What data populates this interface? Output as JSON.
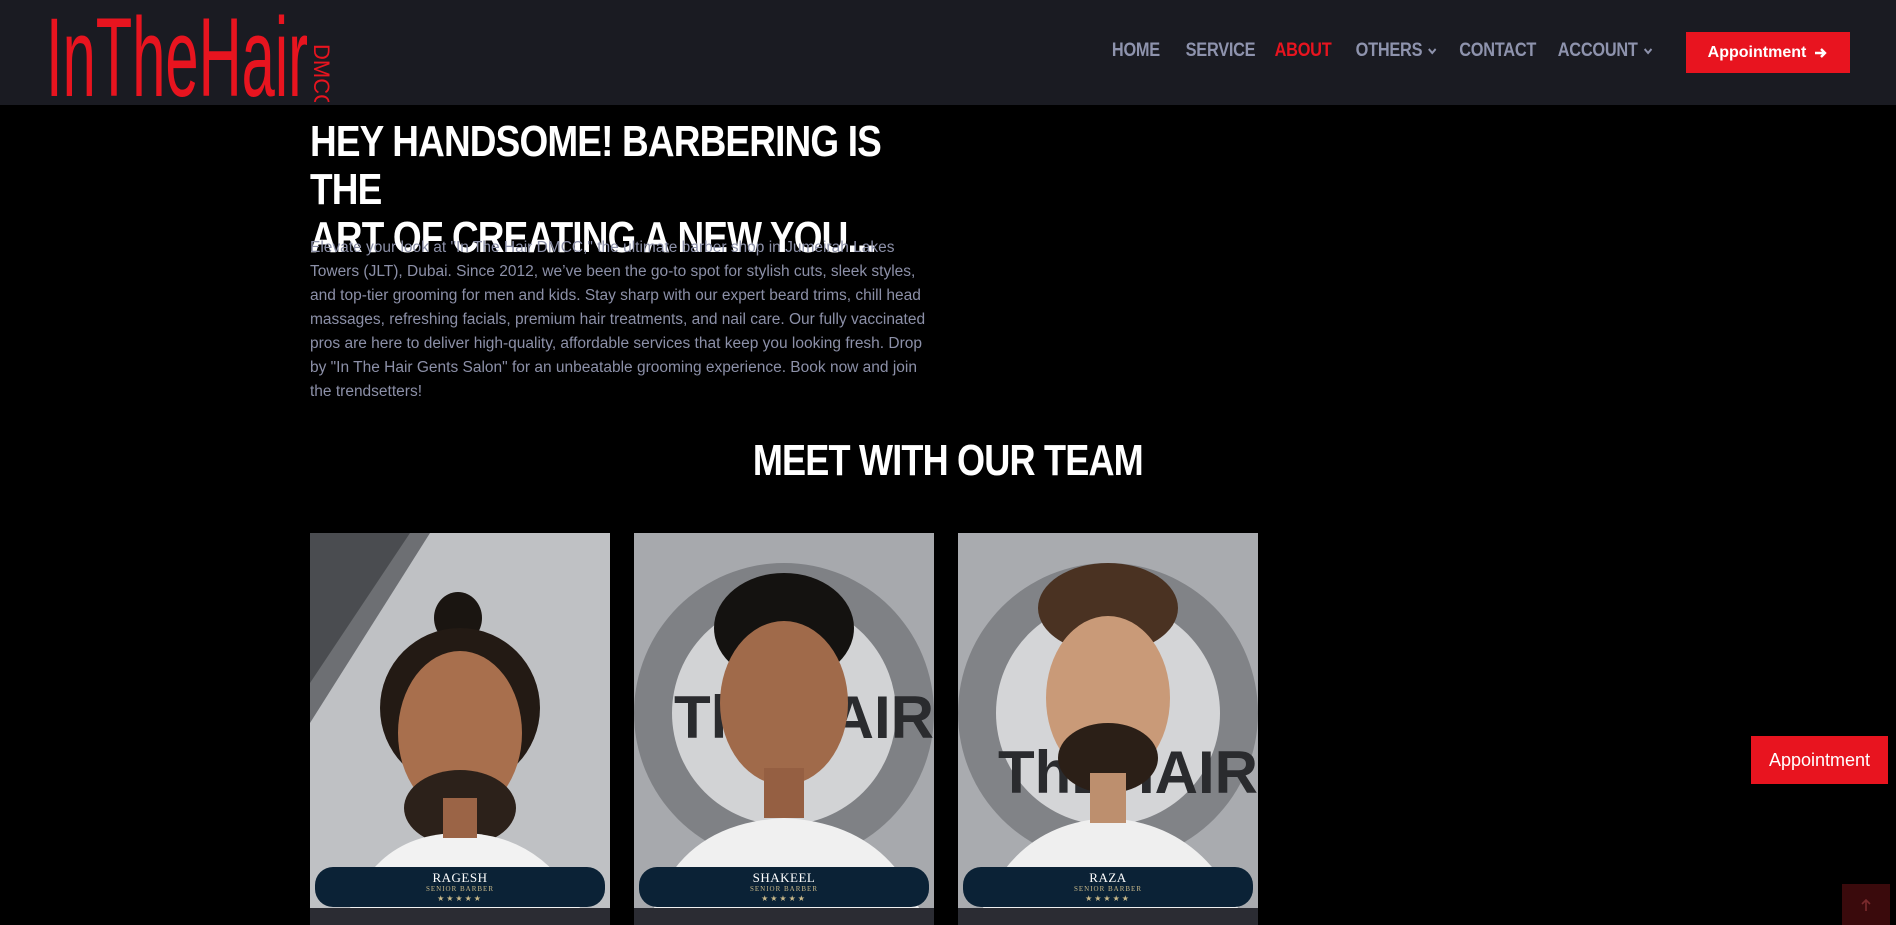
{
  "brand": {
    "logo_main": "InTheHair",
    "logo_sub": "DMCC",
    "accent": "#e8141f",
    "header_bg": "#1a1b22"
  },
  "nav": {
    "items": [
      {
        "label": "HOME",
        "active": false,
        "dropdown": false
      },
      {
        "label": "SERVICE",
        "active": false,
        "dropdown": false
      },
      {
        "label": "ABOUT",
        "active": true,
        "dropdown": false
      },
      {
        "label": "OTHERS",
        "active": false,
        "dropdown": true
      },
      {
        "label": "CONTACT",
        "active": false,
        "dropdown": false
      },
      {
        "label": "ACCOUNT",
        "active": false,
        "dropdown": true
      }
    ],
    "cta_label": "Appointment",
    "cta_icon": "arrow-right-icon"
  },
  "hero": {
    "title_line1": "HEY HANDSOME! BARBERING IS THE",
    "title_line2": "ART OF CREATING A NEW YOU...",
    "paragraph": "Elevate your look at \"In The Hair DMCC,\" the ultimate barber shop in Jumeirah Lakes Towers (JLT), Dubai. Since 2012, we’ve been the go-to spot for stylish cuts, sleek styles, and top-tier grooming for men and kids. Stay sharp with our expert beard trims, chill head massages, refreshing facials, premium hair treatments, and nail care. Our fully vaccinated pros are here to deliver high-quality, affordable services that keep you looking fresh. Drop by \"In The Hair Gents Salon\" for an unbeatable grooming experience. Book now and join the trendsetters!"
  },
  "team": {
    "title": "MEET WITH OUR TEAM",
    "members": [
      {
        "name": "RAGESH",
        "role": "SENIOR BARBER",
        "stars": "★★★★★"
      },
      {
        "name": "SHAKEEL",
        "role": "SENIOR BARBER",
        "stars": "★★★★★"
      },
      {
        "name": "RAZA",
        "role": "SENIOR BARBER",
        "stars": "★★★★★"
      }
    ]
  },
  "floating": {
    "appointment_label": "Appointment",
    "to_top_icon": "arrow-up-icon"
  }
}
